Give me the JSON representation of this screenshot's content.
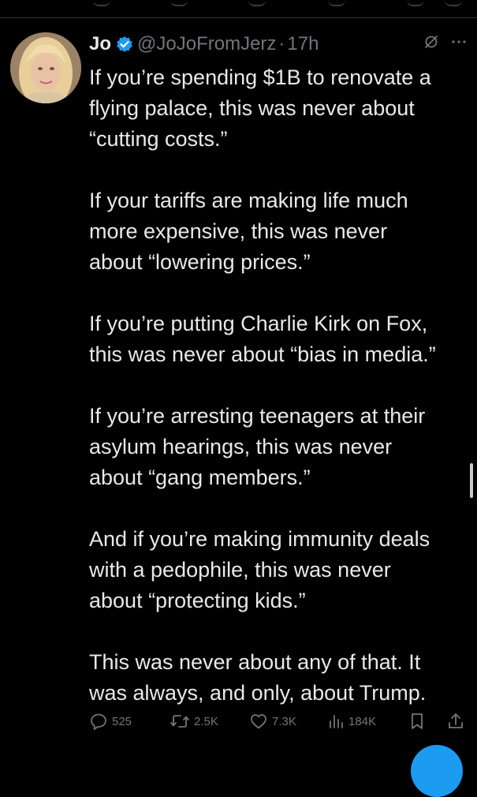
{
  "tweet": {
    "display_name": "Jo",
    "handle": "@JoJoFromJerz",
    "separator": "·",
    "time": "17h",
    "paragraphs": [
      "If you’re spending $1B to renovate a\nflying palace, this was never about\n“cutting costs.”",
      "If your tariffs are making life much\nmore expensive, this was never\nabout “lowering prices.”",
      "If you’re putting Charlie Kirk on Fox,\nthis was never about “bias in media.”",
      "If you’re arresting teenagers at their\nasylum hearings, this was never\nabout “gang members.”",
      "And if you’re making immunity deals\nwith a pedophile, this was never\nabout “protecting kids.”",
      "This was never about any of that. It\nwas always, and only, about Trump."
    ],
    "actions": {
      "replies": "525",
      "reposts": "2.5K",
      "likes": "7.3K",
      "views": "184K"
    }
  },
  "icons": {
    "verified": "verified-badge-icon",
    "grok": "grok-icon",
    "more": "more-icon",
    "reply": "reply-icon",
    "repost": "repost-icon",
    "like": "like-icon",
    "views": "views-icon",
    "bookmark": "bookmark-icon",
    "share": "share-icon"
  },
  "colors": {
    "background": "#000000",
    "text": "#e7e9ea",
    "muted": "#71767b",
    "accent": "#1d9bf0"
  }
}
